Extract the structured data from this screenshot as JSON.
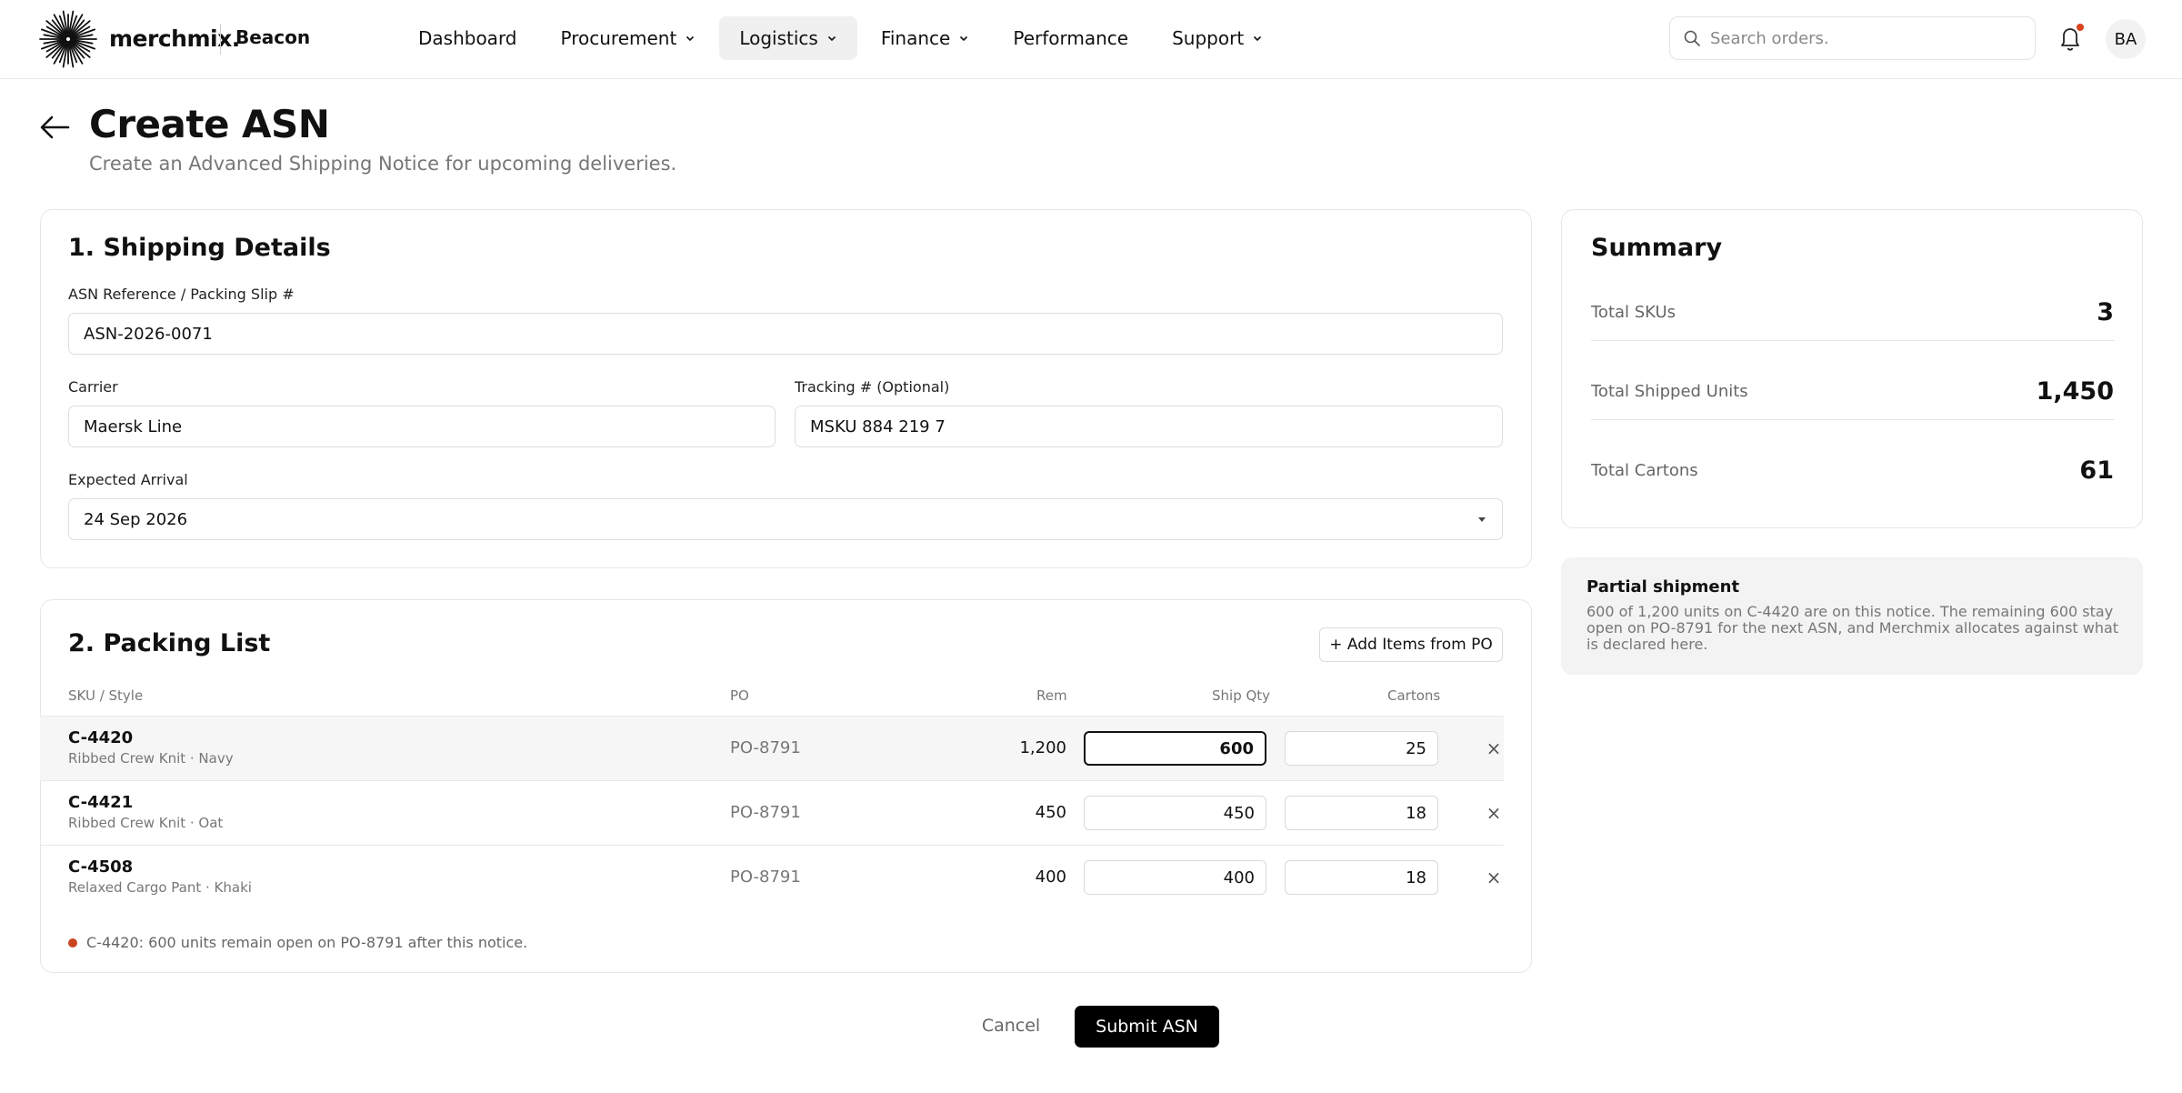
{
  "header": {
    "logo_icon": "sunburst-logo-icon",
    "brand": "merchmix.",
    "product": "Beacon",
    "nav": [
      {
        "label": "Dashboard",
        "dropdown": false,
        "active": false
      },
      {
        "label": "Procurement",
        "dropdown": true,
        "active": false
      },
      {
        "label": "Logistics",
        "dropdown": true,
        "active": true
      },
      {
        "label": "Finance",
        "dropdown": true,
        "active": false
      },
      {
        "label": "Performance",
        "dropdown": false,
        "active": false
      },
      {
        "label": "Support",
        "dropdown": true,
        "active": false
      }
    ],
    "search_placeholder": "Search orders.",
    "notification_icon": "bell-icon",
    "avatar_initials": "BA"
  },
  "page": {
    "title": "Create ASN",
    "subtitle": "Create an Advanced Shipping Notice for upcoming deliveries."
  },
  "shipping": {
    "title": "1. Shipping Details",
    "asn_label": "ASN Reference / Packing Slip #",
    "asn_value": "ASN-2026-0071",
    "carrier_label": "Carrier",
    "carrier_value": "Maersk Line",
    "tracking_label": "Tracking # (Optional)",
    "tracking_value": "MSKU 884 219 7",
    "arrival_label": "Expected Arrival",
    "arrival_value": "24 Sep 2026"
  },
  "packing": {
    "title": "2. Packing List",
    "add_button": "+ Add Items from PO",
    "columns": {
      "sku": "SKU / Style",
      "po": "PO",
      "rem": "Rem",
      "qty": "Ship Qty",
      "cartons": "Cartons"
    },
    "rows": [
      {
        "sku": "C-4420",
        "desc": "Ribbed Crew Knit · Navy",
        "po": "PO-8791",
        "rem": "1,200",
        "qty": "600",
        "cartons": "25"
      },
      {
        "sku": "C-4421",
        "desc": "Ribbed Crew Knit · Oat",
        "po": "PO-8791",
        "rem": "450",
        "qty": "450",
        "cartons": "18"
      },
      {
        "sku": "C-4508",
        "desc": "Relaxed Cargo Pant · Khaki",
        "po": "PO-8791",
        "rem": "400",
        "qty": "400",
        "cartons": "18"
      }
    ],
    "remove_symbol": "×",
    "note": "C-4420: 600 units remain open on PO-8791 after this notice."
  },
  "summary": {
    "title": "Summary",
    "skus_label": "Total SKUs",
    "skus_value": "3",
    "units_label": "Total Shipped Units",
    "units_value": "1,450",
    "cartons_label": "Total Cartons",
    "cartons_value": "61"
  },
  "info": {
    "title": "Partial shipment",
    "body": "600 of 1,200 units on C-4420 are on this notice. The remaining 600 stay open on PO-8791 for the next ASN, and Merchmix allocates against what is declared here."
  },
  "actions": {
    "cancel": "Cancel",
    "submit": "Submit ASN"
  },
  "colors": {
    "accent": "#000000",
    "alert": "#d9431e",
    "active_nav_bg": "#f0f0f0"
  }
}
